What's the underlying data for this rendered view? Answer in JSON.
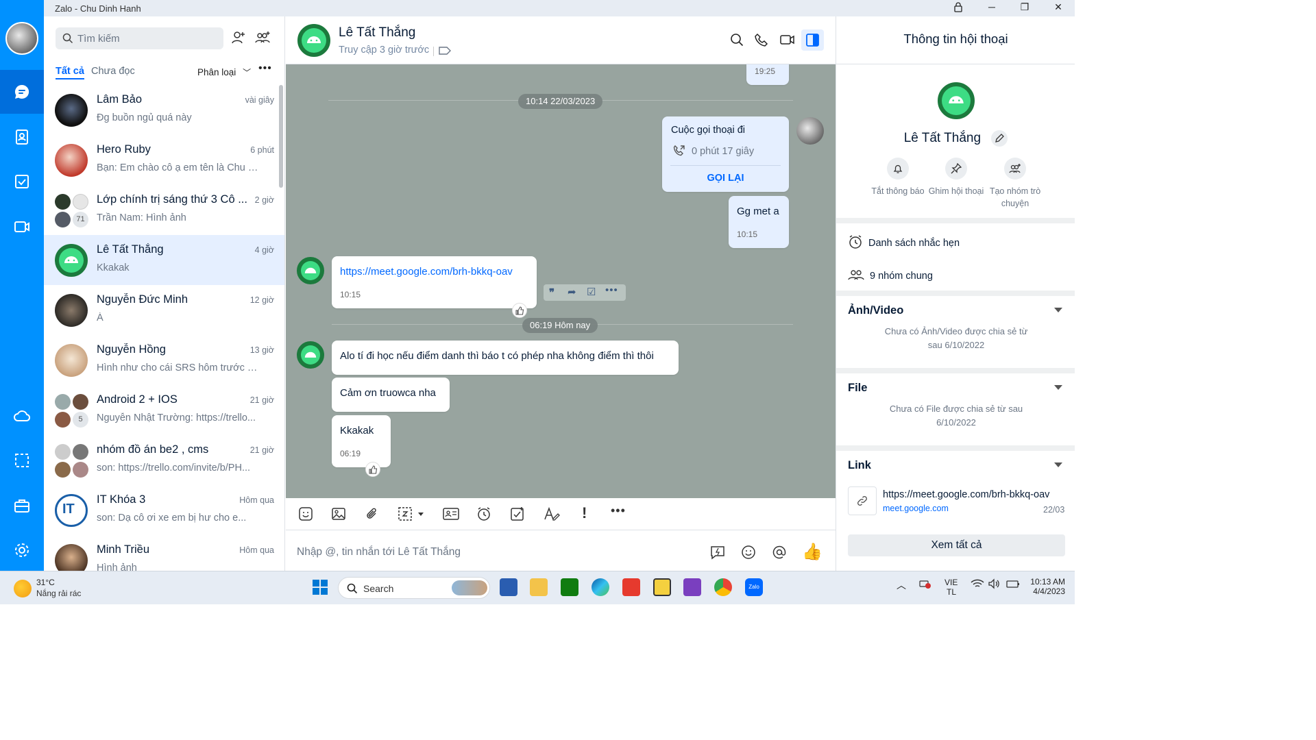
{
  "window": {
    "title": "Zalo - Chu Dinh Hanh"
  },
  "search": {
    "placeholder": "Tìm kiếm"
  },
  "filters": {
    "all": "Tất cả",
    "unread": "Chưa đọc",
    "classify": "Phân loại",
    "more": "•••"
  },
  "conversations": [
    {
      "name": "Lâm Bảo",
      "time": "vài giây",
      "preview": "Đg buồn ngủ quá này"
    },
    {
      "name": "Hero Ruby",
      "time": "6 phút",
      "preview": "Bạn: Em chào cô ạ em tên là Chu Đ..."
    },
    {
      "name": "Lớp chính trị sáng thứ 3 Cô ...",
      "time": "2 giờ",
      "preview": "Trần Nam: Hình ảnh",
      "count": "71"
    },
    {
      "name": "Lê Tất Thắng",
      "time": "4 giờ",
      "preview": "Kkakak"
    },
    {
      "name": "Nguyễn Đức Minh",
      "time": "12 giờ",
      "preview": "Á"
    },
    {
      "name": "Nguyễn Hồng",
      "time": "13 giờ",
      "preview": "Hình như cho cái SRS hôm trước m..."
    },
    {
      "name": "Android 2 + IOS",
      "time": "21 giờ",
      "preview": "Nguyễn Nhật Trường: https://trello...",
      "count": "5"
    },
    {
      "name": "nhóm đồ án be2 , cms",
      "time": "21 giờ",
      "preview": "son: https://trello.com/invite/b/PH..."
    },
    {
      "name": "IT Khóa 3",
      "time": "Hôm qua",
      "preview": "son: Dạ cô ơi xe em bị hư cho e..."
    },
    {
      "name": "Minh Triều",
      "time": "Hôm qua",
      "preview": "Hình ảnh"
    }
  ],
  "chat": {
    "name": "Lê Tất Thắng",
    "status": "Truy cập 3 giờ trước",
    "composer_placeholder": "Nhập @, tin nhắn tới Lê Tất Thắng",
    "top_time": "19:25",
    "date1": "10:14 22/03/2023",
    "call_title": "Cuộc gọi thoại đi",
    "call_duration": "0 phút 17 giây",
    "call_back": "GỌI LẠI",
    "msg_me": "Gg met a",
    "msg_me_time": "10:15",
    "link_msg": "https://meet.google.com/brh-bkkq-oav",
    "link_msg_time": "10:15",
    "date2": "06:19 Hôm nay",
    "msg_a": "Alo tí đi học nếu điểm danh thì báo t có phép nha không điểm thì thôi",
    "msg_b": "Cảm ơn truowca nha",
    "msg_c": "Kkakak",
    "msg_c_time": "06:19"
  },
  "info": {
    "title": "Thông tin hội thoại",
    "name": "Lê Tất Thắng",
    "actions": [
      {
        "label": "Tắt thông báo"
      },
      {
        "label": "Ghim hội thoại"
      },
      {
        "label": "Tạo nhóm trò chuyện"
      }
    ],
    "reminders": "Danh sách nhắc hẹn",
    "groups": "9 nhóm chung",
    "media_title": "Ảnh/Video",
    "media_empty": "Chưa có Ảnh/Video được chia sẻ từ sau 6/10/2022",
    "file_title": "File",
    "file_empty": "Chưa có File được chia sẻ từ sau 6/10/2022",
    "link_title": "Link",
    "link_url": "https://meet.google.com/brh-bkkq-oav",
    "link_domain": "meet.google.com",
    "link_date": "22/03",
    "see_all": "Xem tất cả"
  },
  "taskbar": {
    "temp": "31°C",
    "weather": "Nắng rải rác",
    "search": "Search",
    "lang1": "VIE",
    "lang2": "TL",
    "time": "10:13 AM",
    "date": "4/4/2023"
  },
  "colors": {
    "brand": "#0091ff",
    "accent": "#0068ff",
    "chat_bg": "#98a49f",
    "android": "#3ddc84"
  }
}
